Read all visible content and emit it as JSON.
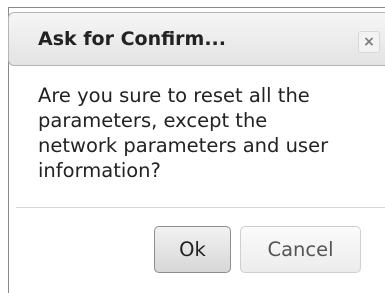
{
  "dialog": {
    "title": "Ask for Confirm...",
    "close_glyph": "×",
    "close_icon": "close-icon",
    "message_lines": [
      "Are you sure to reset all the",
      "parameters, except the",
      "network parameters and user",
      "information?"
    ],
    "ok_label": "Ok",
    "cancel_label": "Cancel"
  }
}
